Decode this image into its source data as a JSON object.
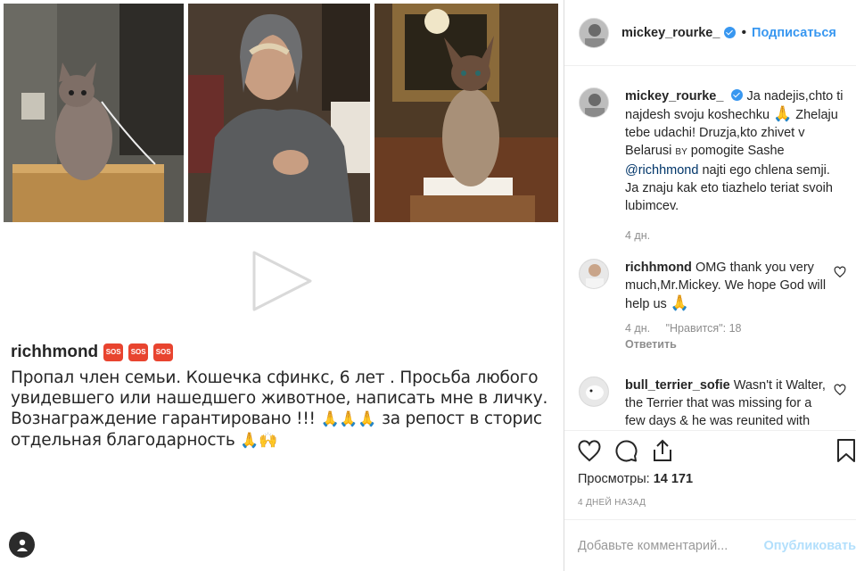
{
  "caption": {
    "username": "richhmond",
    "line1": "Пропал член семьи. Кошечка сфинкс, 6 лет . Просьба любого",
    "line2": "увидевшего или нашедшего животное, написать мне в личку.",
    "line3a": "Вознаграждение гарантировано !!!",
    "line3b": "за репост в сторис",
    "line4": "отдельная благодарность",
    "sos_label": "SOS"
  },
  "header": {
    "username": "mickey_rourke_",
    "separator": "•",
    "follow": "Подписаться"
  },
  "post": {
    "username": "mickey_rourke_",
    "text_a": "Ja nadejis,chto ti najdesh svoju koshechku",
    "text_b": "Zhelaju tebe udachi! Druzja,kto zhivet v Belarusi",
    "flag": "BY",
    "text_c": "pomogite Sashe",
    "mention": "@richhmond",
    "text_d": "najti ego chlena semji. Ja znaju kak eto tiazhelo teriat svoih lubimcev.",
    "time": "4 дн."
  },
  "comments": [
    {
      "username": "richhmond",
      "text": "OMG thank you very much,Mr.Mickey. We hope God will help us",
      "time": "4 дн.",
      "likes": "\"Нравится\": 18",
      "reply": "Ответить"
    },
    {
      "username": "bull_terrier_sofie",
      "text": "Wasn't it Walter, the Terrier that was missing for a few days & he was reunited with"
    }
  ],
  "stats": {
    "views_label": "Просмотры:",
    "views_value": "14 171",
    "timeago": "4 ДНЕЙ НАЗАД"
  },
  "add_comment": {
    "placeholder": "Добавьте комментарий...",
    "publish": "Опубликовать"
  },
  "colors": {
    "accent": "#3897f0",
    "sos": "#e8442f"
  }
}
